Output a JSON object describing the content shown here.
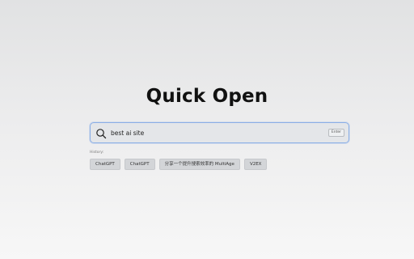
{
  "app": {
    "title": "Quick Open"
  },
  "search": {
    "value": "best ai site",
    "placeholder": "",
    "enter_label": "Enter",
    "icon": "search-icon"
  },
  "history": {
    "label": "History:",
    "items": [
      {
        "label": "ChatGPT"
      },
      {
        "label": "ChatGPT"
      },
      {
        "label": "分享一个提升搜索效率的 MultiAge"
      },
      {
        "label": "V2EX"
      }
    ]
  },
  "colors": {
    "focus_border": "#8aaee6",
    "chip_background": "#d3d5d8",
    "title_text": "#111111"
  }
}
